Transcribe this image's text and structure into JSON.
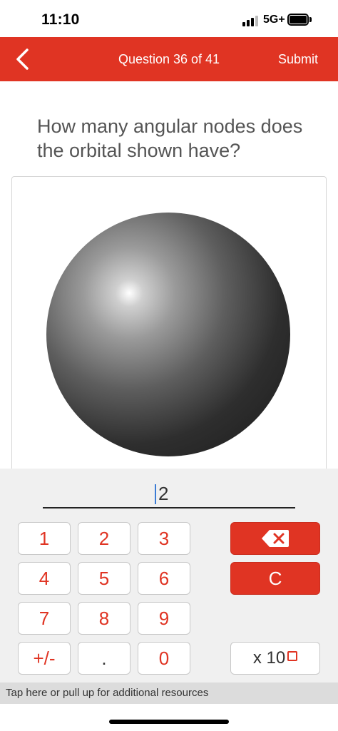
{
  "status_bar": {
    "time": "11:10",
    "network": "5G+"
  },
  "header": {
    "title": "Question 36 of 41",
    "submit_label": "Submit"
  },
  "question": {
    "text": "How many angular nodes does the orbital shown have?"
  },
  "answer": {
    "value": "2"
  },
  "keypad": {
    "digits": [
      "1",
      "2",
      "3",
      "4",
      "5",
      "6",
      "7",
      "8",
      "9",
      "+/-",
      ".",
      "0"
    ],
    "clear_label": "C",
    "x10_label": "x 10"
  },
  "resources": {
    "text": "Tap here or pull up for additional resources"
  },
  "colors": {
    "brand_red": "#e03423"
  }
}
